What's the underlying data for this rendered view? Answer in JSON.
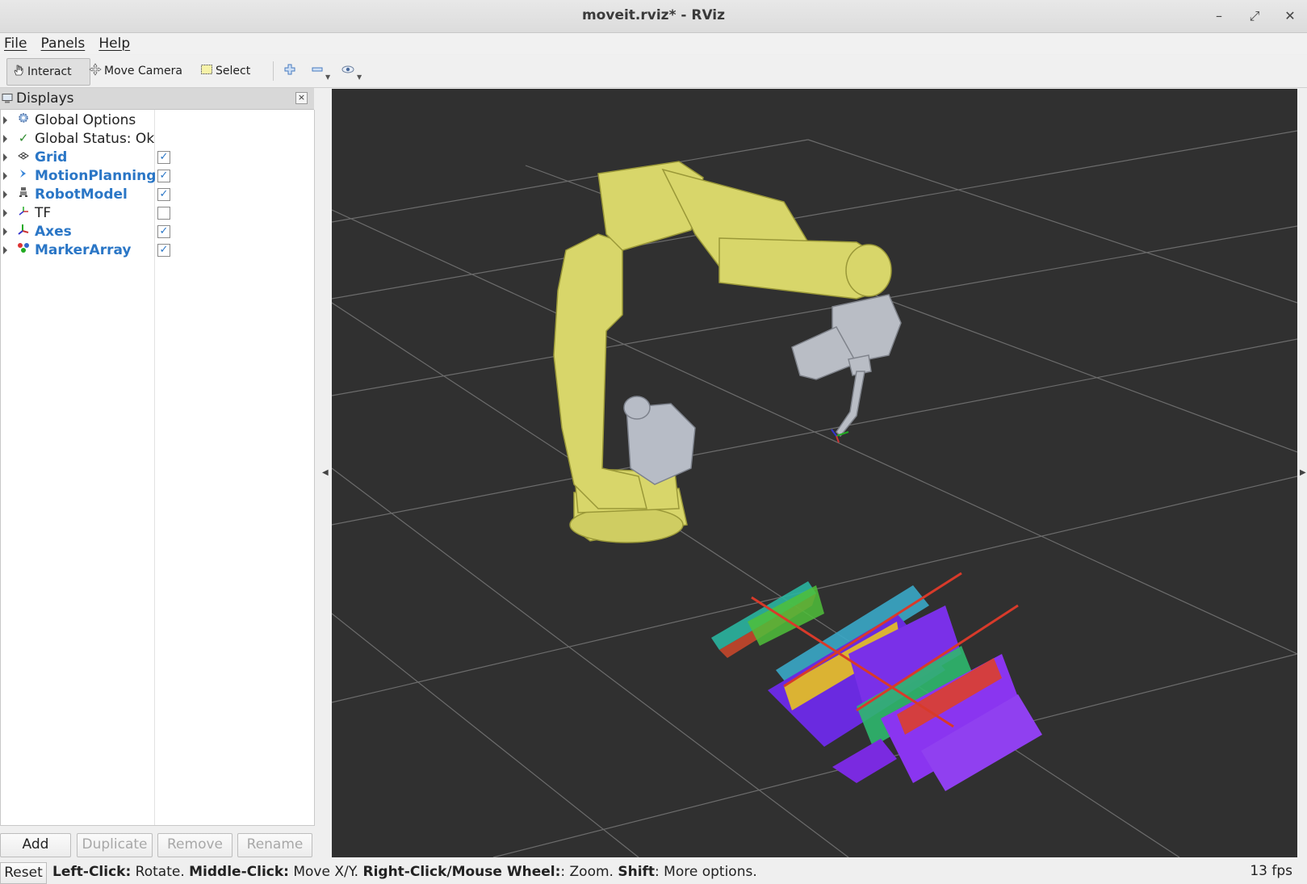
{
  "window": {
    "title": "moveit.rviz* - RViz",
    "minimize": "–",
    "maximize": "⤢",
    "close": "✕"
  },
  "menu": [
    "File",
    "Panels",
    "Help"
  ],
  "toolbar": {
    "interact": "Interact",
    "move_camera": "Move Camera",
    "select": "Select",
    "add_icon": "plus-icon",
    "remove_icon": "minus-icon",
    "focus_icon": "eye-icon"
  },
  "displays_panel": {
    "title": "Displays",
    "close": "×",
    "items": [
      {
        "label": "Global Options",
        "icon": "gear-icon",
        "checked": null,
        "is_display": false
      },
      {
        "label": "Global Status: Ok",
        "icon": "check-icon",
        "checked": null,
        "is_display": false
      },
      {
        "label": "Grid",
        "icon": "grid-icon",
        "checked": true,
        "is_display": true
      },
      {
        "label": "MotionPlanning",
        "icon": "motion-planning-icon",
        "checked": true,
        "is_display": true
      },
      {
        "label": "RobotModel",
        "icon": "robot-icon",
        "checked": true,
        "is_display": true
      },
      {
        "label": "TF",
        "icon": "tf-icon",
        "checked": false,
        "is_display": false
      },
      {
        "label": "Axes",
        "icon": "axes-icon",
        "checked": true,
        "is_display": true
      },
      {
        "label": "MarkerArray",
        "icon": "marker-icon",
        "checked": true,
        "is_display": true
      }
    ],
    "buttons": {
      "add": "Add",
      "duplicate": "Duplicate",
      "remove": "Remove",
      "rename": "Rename"
    }
  },
  "status": {
    "reset": "Reset",
    "t1": "Left-Click:",
    "t2": " Rotate. ",
    "t3": "Middle-Click:",
    "t4": " Move X/Y. ",
    "t5": "Right-Click/Mouse Wheel:",
    "t6": ": Zoom. ",
    "t7": "Shift",
    "t8": ": More options.",
    "fps": "13 fps"
  },
  "colors": {
    "viewport_bg": "#303030",
    "robot": "#d8d66a",
    "display_blue": "#2a76c6"
  }
}
